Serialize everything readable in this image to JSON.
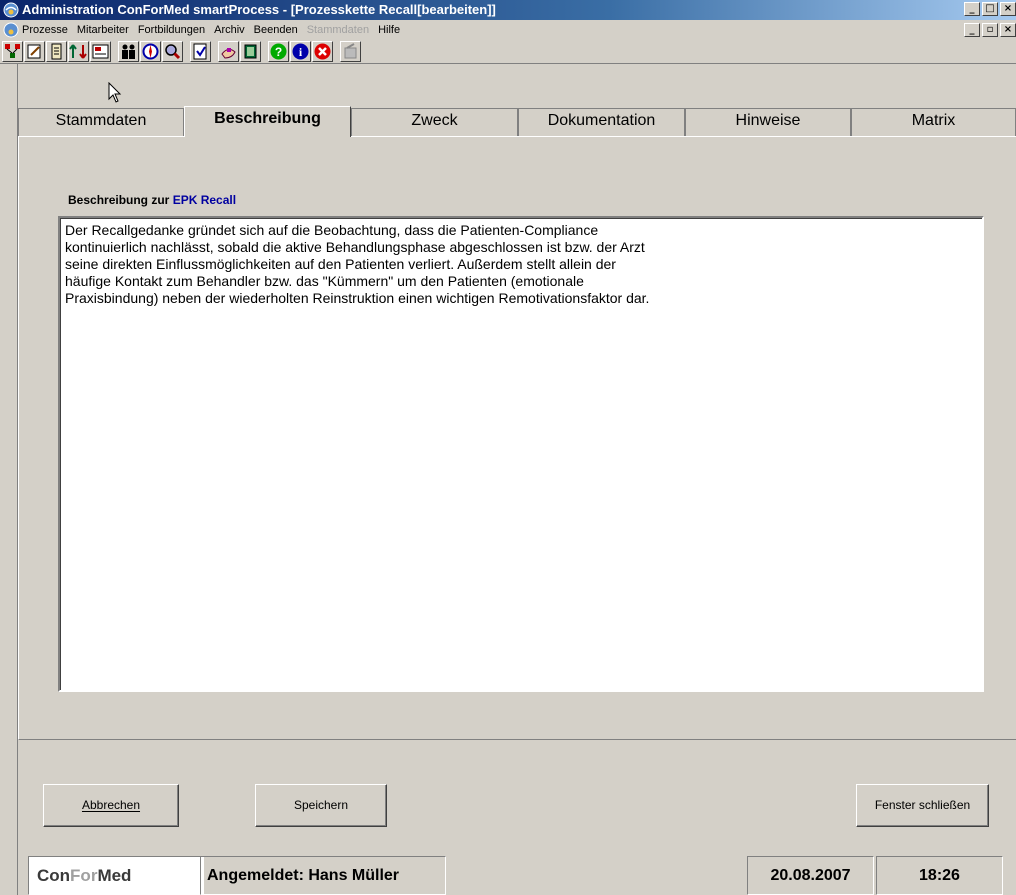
{
  "window": {
    "title": "Administration ConForMed   smartProcess - [Prozesskette Recall[bearbeiten]]",
    "controls": [
      "_",
      "□",
      "×"
    ]
  },
  "menu": {
    "items": [
      {
        "label": "Prozesse",
        "enabled": true
      },
      {
        "label": "Mitarbeiter",
        "enabled": true
      },
      {
        "label": "Fortbildungen",
        "enabled": true
      },
      {
        "label": "Archiv",
        "enabled": true
      },
      {
        "label": "Beenden",
        "enabled": true
      },
      {
        "label": "Stammdaten",
        "enabled": false
      },
      {
        "label": "Hilfe",
        "enabled": true
      }
    ],
    "mdi_controls": [
      "_",
      "▫",
      "×"
    ]
  },
  "toolbar": {
    "icons": [
      "network-icon",
      "edit-icon",
      "scroll-icon",
      "arrows-icon",
      "report-icon",
      "people-icon",
      "compass-icon",
      "search-icon",
      "document-icon",
      "hand-icon",
      "book-icon",
      "help-icon",
      "info-icon",
      "exit-icon",
      "disabled-tool-icon"
    ]
  },
  "tabs": [
    {
      "label": "Stammdaten",
      "active": false
    },
    {
      "label": "Beschreibung",
      "active": true
    },
    {
      "label": "Zweck",
      "active": false
    },
    {
      "label": "Dokumentation",
      "active": false
    },
    {
      "label": "Hinweise",
      "active": false
    },
    {
      "label": "Matrix",
      "active": false
    }
  ],
  "description": {
    "label_prefix": "Beschreibung zur",
    "label_name": "EPK Recall",
    "text": "Der Recallgedanke gründet sich auf die Beobachtung, dass die Patienten-Compliance\nkontinuierlich nachlässt, sobald die aktive Behandlungsphase abgeschlossen ist bzw. der Arzt\nseine direkten Einflussmöglichkeiten auf den Patienten verliert. Außerdem stellt allein der\nhäufige Kontakt zum Behandler bzw. das \"Kümmern\" um den Patienten (emotionale\nPraxisbindung) neben der wiederholten Reinstruktion einen wichtigen Remotivationsfaktor dar."
  },
  "buttons": {
    "cancel_label": "Abbrechen",
    "save_label": "Speichern",
    "close_label": "Fenster schließen"
  },
  "status": {
    "logo_part1": "Con",
    "logo_part2": "For",
    "logo_part3": "Med",
    "user": "Angemeldet: Hans Müller",
    "date": "20.08.2007",
    "time": "18:26"
  },
  "colors": {
    "face": "#d4d0c8",
    "title_start": "#0a246a",
    "title_end": "#a6caf0",
    "epk_label": "#0000a0"
  }
}
